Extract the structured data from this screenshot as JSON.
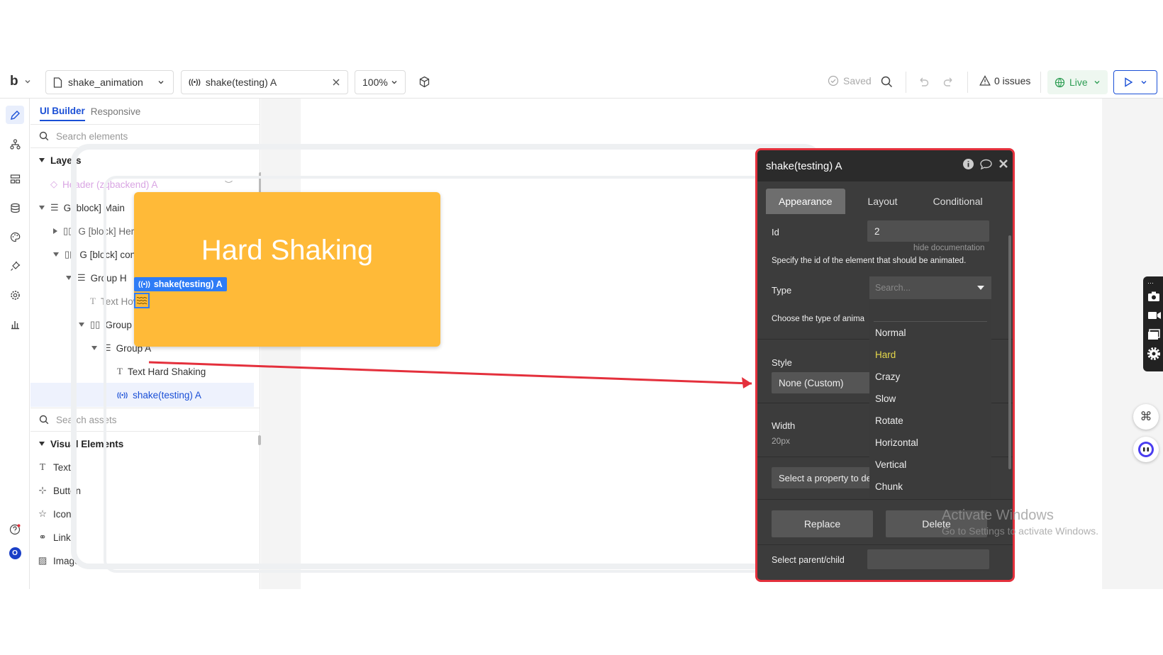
{
  "topbar": {
    "logo": "b",
    "page_name": "shake_animation",
    "element_name": "shake(testing) A",
    "zoom": "100%",
    "saved": "Saved",
    "issues": "0 issues",
    "live": "Live"
  },
  "panel": {
    "tabs": [
      "UI Builder",
      "Responsive"
    ],
    "search_placeholder": "Search elements",
    "layers_title": "Layers",
    "layers": [
      {
        "label": "Header (zqbackend) A"
      },
      {
        "label": "G [block] Main"
      },
      {
        "label": "G [block] Hero"
      },
      {
        "label": "G [block] content"
      },
      {
        "label": "Group H"
      },
      {
        "label": "Text Hover over the ele..."
      },
      {
        "label": "Group K"
      },
      {
        "label": "Group A"
      },
      {
        "label": "Text Hard Shaking"
      },
      {
        "label": "shake(testing) A"
      }
    ],
    "assets_placeholder": "Search assets",
    "visual_title": "Visual Elements",
    "visual_elements": [
      "Text",
      "Button",
      "Icon",
      "Link",
      "Image"
    ]
  },
  "canvas": {
    "orange_title": "Hard Shaking",
    "element_label": "shake(testing) A"
  },
  "property_editor": {
    "title": "shake(testing) A",
    "tabs": [
      "Appearance",
      "Layout",
      "Conditional"
    ],
    "id_label": "Id",
    "id_value": "2",
    "hide_doc": "hide documentation",
    "id_doc": "Specify the id of the element that should be animated.",
    "type_label": "Type",
    "type_doc": "Choose the type of anima",
    "style_label": "Style",
    "style_value": "None (Custom)",
    "width_label": "Width",
    "width_value": "20px",
    "select_property": "Select a property to de",
    "replace": "Replace",
    "delete": "Delete",
    "parent_child": "Select parent/child",
    "dropdown": {
      "placeholder": "Search...",
      "options": [
        "Normal",
        "Hard",
        "Crazy",
        "Slow",
        "Rotate",
        "Horizontal",
        "Vertical",
        "Chunk"
      ],
      "highlighted": "Hard"
    }
  },
  "watermark": {
    "line1": "Activate Windows",
    "line2": "Go to Settings to activate Windows."
  },
  "colors": {
    "accent": "#1a4fd6",
    "orange": "#ffba38",
    "highlight_border": "#e4303c",
    "live": "#2f9e55"
  }
}
